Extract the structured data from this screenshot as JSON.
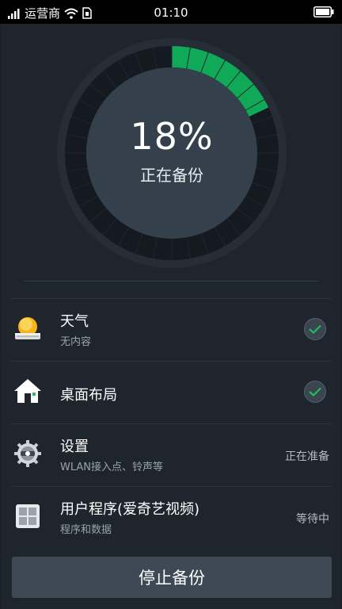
{
  "status_bar": {
    "carrier": "运营商",
    "time": "01:10"
  },
  "progress": {
    "percent_label": "18%",
    "status_label": "正在备份",
    "value": 0.18,
    "accent_color": "#0fa958"
  },
  "items": [
    {
      "title": "天气",
      "subtitle": "无内容",
      "state": "done",
      "status_text": ""
    },
    {
      "title": "桌面布局",
      "subtitle": "",
      "state": "done",
      "status_text": ""
    },
    {
      "title": "设置",
      "subtitle": "WLAN接入点、铃声等",
      "state": "pending",
      "status_text": "正在准备"
    },
    {
      "title": "用户程序(爱奇艺视频)",
      "subtitle": "程序和数据",
      "state": "pending",
      "status_text": "等待中"
    }
  ],
  "stop_button": {
    "label": "停止备份"
  }
}
